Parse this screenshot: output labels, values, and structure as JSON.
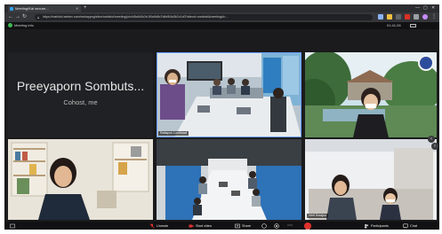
{
  "browser": {
    "tab_title": "Meeting/Kal secure...",
    "url": "https://mahidol.webex.com/webappng/sites/mahidol/meeting/join/d5a4b3c2e1f0a9b8c7d6e5f4a3b2c1d0?siteurl=mahidol&meetingid=...",
    "colors": {
      "chrome": "#35363a",
      "tab": "#3b3c40"
    }
  },
  "meeting": {
    "title": "Meeting info",
    "time": "01:41:28",
    "participants": [
      {
        "name": "Preeyaporn Sombuts...",
        "subtitle": "Cohost, me",
        "video": false
      },
      {
        "name": "Rattapon Lomthawi",
        "video": true,
        "active": true
      },
      {
        "name": "",
        "video": true
      },
      {
        "name": "",
        "video": true
      },
      {
        "name": "",
        "video": true
      },
      {
        "name": "Vieti Sorajoo",
        "video": true
      }
    ]
  },
  "controls": {
    "mute": "Unmute",
    "video": "Start video",
    "share": "Share",
    "participants": "Participants",
    "chat": "Chat",
    "accent_end": "#e0322d",
    "accent_mic_off": "#e0322d"
  }
}
